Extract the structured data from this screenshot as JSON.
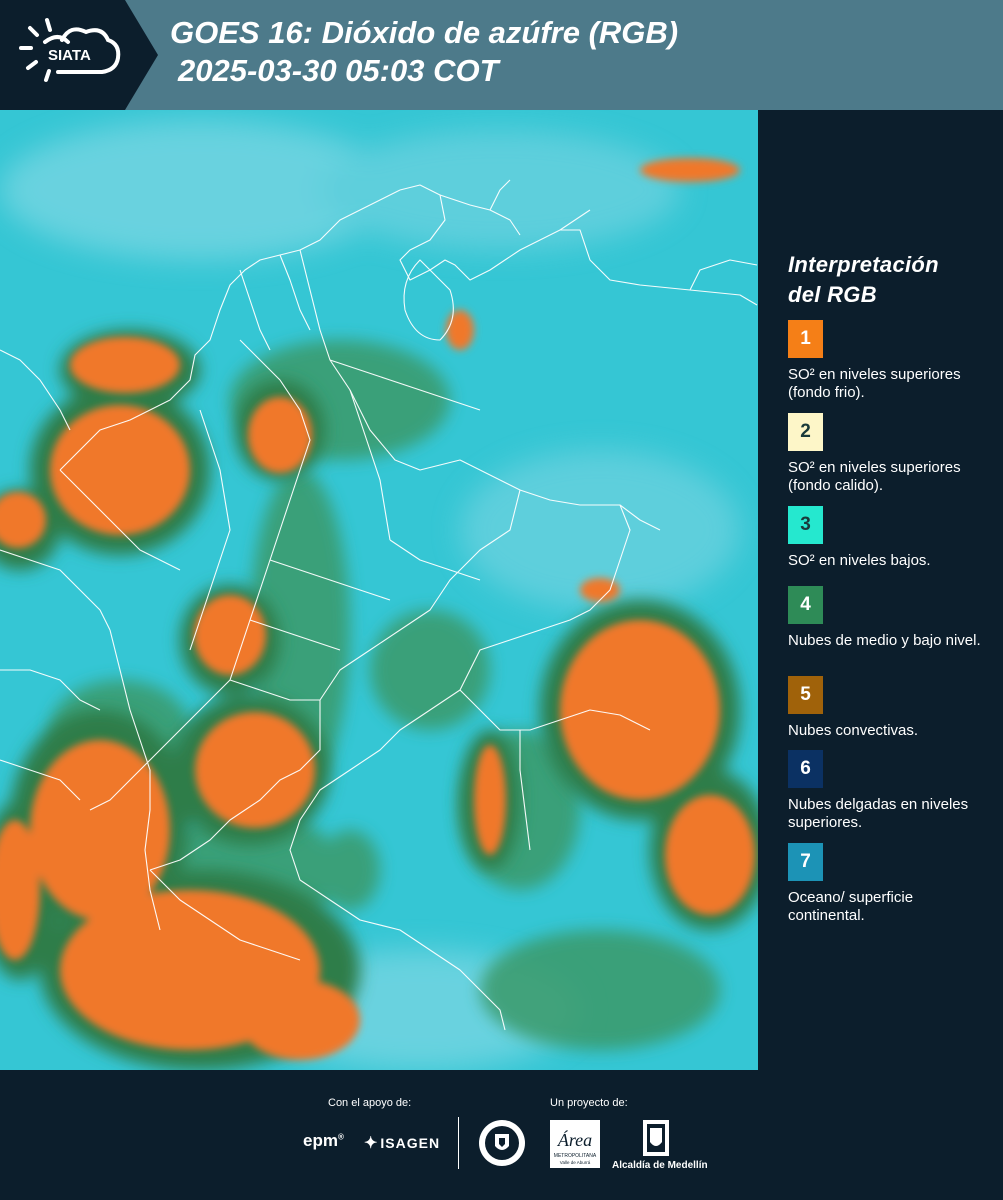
{
  "header": {
    "logo_text": "SIATA",
    "title_line1": "GOES 16: Dióxido de azúfre (RGB)",
    "title_line2": "2025-03-30 05:03 COT",
    "bg_color": "#4d7a8a"
  },
  "legend": {
    "title_line1": "Interpretación",
    "title_line2": "del RGB",
    "items": [
      {
        "number": "1",
        "color": "#f57f17",
        "label": "SO² en niveles superiores (fondo frio)."
      },
      {
        "number": "2",
        "color": "#fdf6c8",
        "label": "SO² en niveles superiores (fondo calido)."
      },
      {
        "number": "3",
        "color": "#25e8cf",
        "label": "SO² en niveles bajos."
      },
      {
        "number": "4",
        "color": "#2e8b57",
        "label": "Nubes de medio y bajo nivel."
      },
      {
        "number": "5",
        "color": "#a0620a",
        "label": "Nubes convectivas."
      },
      {
        "number": "6",
        "color": "#0b3163",
        "label": "Nubes delgadas en niveles superiores."
      },
      {
        "number": "7",
        "color": "#1c93b6",
        "label": "Oceano/ superficie continental."
      }
    ]
  },
  "footer": {
    "support_label": "Con el apoyo de:",
    "project_label": "Un proyecto de:",
    "epm": "epm",
    "isagen": "ISAGEN",
    "amva_top": "Área",
    "amva_mid": "METROPOLITANA",
    "amva_bot": "Valle de Aburrá",
    "alcaldia": "Alcaldía de Medellín"
  }
}
